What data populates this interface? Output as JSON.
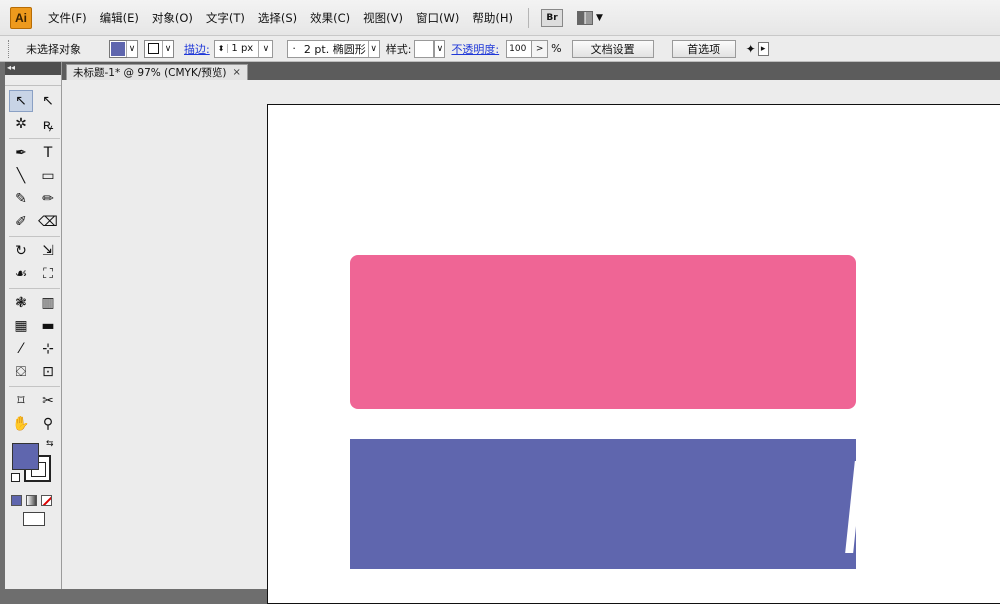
{
  "app": {
    "logo": "Ai"
  },
  "menu": [
    "文件(F)",
    "编辑(E)",
    "对象(O)",
    "文字(T)",
    "选择(S)",
    "效果(C)",
    "视图(V)",
    "窗口(W)",
    "帮助(H)"
  ],
  "menu_extras": {
    "bridge_label": "Br",
    "workspace_icon": "arrange-documents-icon"
  },
  "control": {
    "selection_label": "未选择对象",
    "stroke_label": "描边:",
    "stroke_weight": "1 px",
    "brush_dot": "·",
    "brush_label": "2 pt. 椭圆形",
    "style_label": "样式:",
    "opacity_label": "不透明度:",
    "opacity_value": "100",
    "opacity_arrow": ">",
    "percent": "%",
    "doc_setup_button": "文档设置",
    "preferences_button": "首选项",
    "fill_color": "#5f66ae"
  },
  "toolbar_header": "◂◂",
  "document": {
    "tab_title": "未标题-1* @ 97% (CMYK/预览)",
    "close": "×"
  },
  "tools": [
    {
      "name": "selection-tool",
      "glyph": "↖"
    },
    {
      "name": "direct-selection-tool",
      "glyph": "↖"
    },
    {
      "name": "magic-wand-tool",
      "glyph": "✲"
    },
    {
      "name": "lasso-tool",
      "glyph": "ꝶ"
    },
    {
      "name": "pen-tool",
      "glyph": "✒"
    },
    {
      "name": "type-tool",
      "glyph": "T"
    },
    {
      "name": "line-tool",
      "glyph": "╲"
    },
    {
      "name": "rectangle-tool",
      "glyph": "▭"
    },
    {
      "name": "paintbrush-tool",
      "glyph": "✎"
    },
    {
      "name": "pencil-tool",
      "glyph": "✏"
    },
    {
      "name": "blob-brush-tool",
      "glyph": "✐"
    },
    {
      "name": "eraser-tool",
      "glyph": "⌫"
    },
    {
      "name": "rotate-tool",
      "glyph": "↻"
    },
    {
      "name": "scale-tool",
      "glyph": "⇲"
    },
    {
      "name": "warp-tool",
      "glyph": "☙"
    },
    {
      "name": "free-transform-tool",
      "glyph": "⛶"
    },
    {
      "name": "symbol-sprayer-tool",
      "glyph": "❃"
    },
    {
      "name": "column-graph-tool",
      "glyph": "▥"
    },
    {
      "name": "mesh-tool",
      "glyph": "▦"
    },
    {
      "name": "gradient-tool",
      "glyph": "▬"
    },
    {
      "name": "eyedropper-tool",
      "glyph": "⁄"
    },
    {
      "name": "blend-tool",
      "glyph": "⊹"
    },
    {
      "name": "live-paint-bucket-tool",
      "glyph": "⛋"
    },
    {
      "name": "live-paint-selection-tool",
      "glyph": "⊡"
    },
    {
      "name": "artboard-tool",
      "glyph": "⌑"
    },
    {
      "name": "slice-tool",
      "glyph": "✂"
    },
    {
      "name": "hand-tool",
      "glyph": "✋"
    },
    {
      "name": "zoom-tool",
      "glyph": "⚲"
    }
  ],
  "artwork": {
    "pink_color": "#ef6595",
    "blue_color": "#5f66ae"
  }
}
